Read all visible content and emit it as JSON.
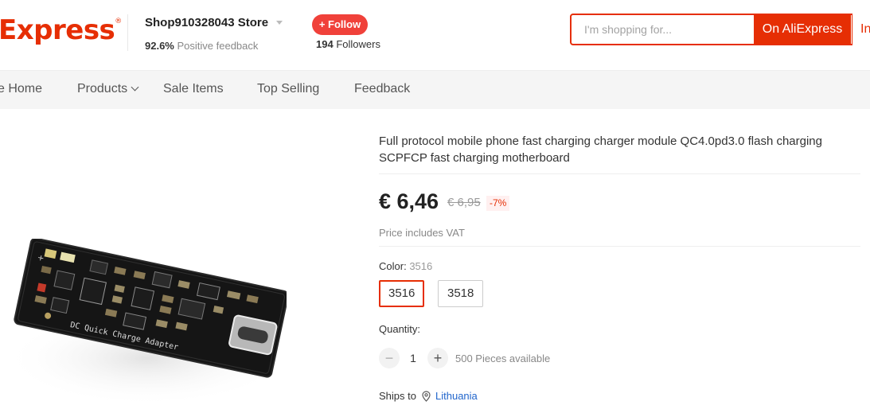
{
  "header": {
    "logo_text": "Express",
    "store_name": "Shop910328043 Store",
    "feedback_value": "92.6%",
    "feedback_label": "Positive feedback",
    "follow_label": "+ Follow",
    "followers_count": "194",
    "followers_label": "Followers",
    "search_placeholder": "I'm shopping for...",
    "search_button": "On AliExpress",
    "search_button2": "In"
  },
  "nav": {
    "items": [
      "e Home",
      "Products",
      "Sale Items",
      "Top Selling",
      "Feedback"
    ]
  },
  "product": {
    "title": "Full protocol mobile phone fast charging charger module QC4.0pd3.0 flash charging SCPFCP fast charging motherboard",
    "price": "€ 6,46",
    "original_price": "€ 6,95",
    "discount": "-7%",
    "vat_note": "Price includes VAT",
    "color_label": "Color:",
    "color_selected": "3516",
    "color_options": [
      "3516",
      "3518"
    ],
    "quantity_label": "Quantity:",
    "quantity": "1",
    "available": "500 Pieces available",
    "ships_label": "Ships to",
    "ships_country": "Lithuania",
    "board_print": "DC Quick Charge Adapter"
  },
  "colors": {
    "accent": "#e62e04",
    "follow": "#f0413a",
    "link": "#2266cc"
  }
}
